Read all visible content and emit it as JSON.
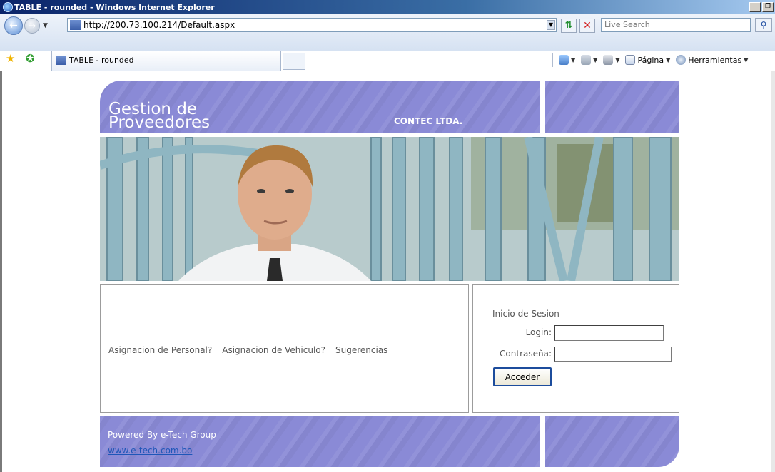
{
  "window": {
    "title": "TABLE - rounded - Windows Internet Explorer",
    "controls": [
      "_",
      "❐",
      "×"
    ]
  },
  "address_bar": {
    "url": "http://200.73.100.214/Default.aspx",
    "search_placeholder": "Live Search"
  },
  "tabs": [
    {
      "label": "TABLE - rounded",
      "active": true
    }
  ],
  "command_bar": {
    "page_label": "Página",
    "tools_label": "Herramientas"
  },
  "page": {
    "title": "Gestion de\nProveedores",
    "company": "CONTEC LTDA.",
    "nav_links": [
      "Asignacion de Personal?",
      "Asignacion de Vehiculo?",
      "Sugerencias"
    ],
    "login": {
      "heading": "Inicio de Sesion",
      "login_label": "Login:",
      "password_label": "Contraseña:",
      "login_value": "",
      "password_value": "",
      "submit_label": "Acceder"
    },
    "footer": {
      "powered_by": "Powered By e-Tech Group",
      "link": "www.e-tech.com.bo"
    }
  },
  "colors": {
    "header_purple": "#8a8ad6",
    "text_gray": "#555555",
    "link_blue": "#1e56b8"
  }
}
